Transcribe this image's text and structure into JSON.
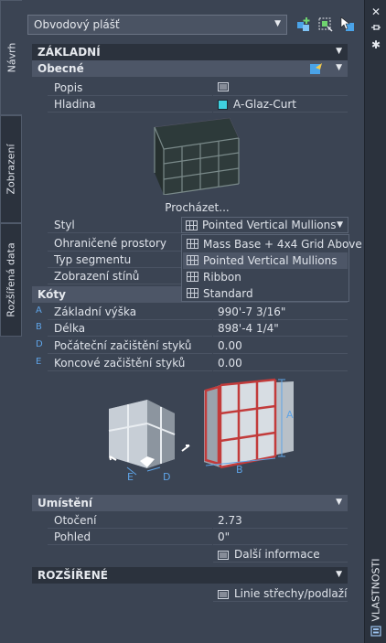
{
  "tabs": {
    "navrh": "Návrh",
    "zobrazeni": "Zobrazení",
    "rozsirena": "Rozšířená data"
  },
  "right_strip": {
    "title": "VLASTNOSTI",
    "icons": [
      "close-icon",
      "pin-icon",
      "settings-icon",
      "properties-icon"
    ]
  },
  "top": {
    "object_type": "Obvodový plášť"
  },
  "sections": {
    "zakladni": "ZÁKLADNÍ",
    "obecne": "Obecné",
    "koty": "Kóty",
    "umisteni": "Umístění",
    "rozsirene": "ROZŠÍŘENÉ"
  },
  "general": {
    "popis_label": "Popis",
    "hladina_label": "Hladina",
    "hladina_value": "A-Glaz-Curt",
    "hladina_color": "#3fd0e0",
    "browse": "Procházet...",
    "styl_label": "Styl",
    "styl_value": "Pointed Vertical Mullions",
    "ohranicene_label": "Ohraničené prostory",
    "typ_label": "Typ segmentu",
    "zobrazeni_label": "Zobrazení stínů"
  },
  "style_options": [
    "Mass Base + 4x4 Grid Above",
    "Pointed Vertical Mullions",
    "Ribbon",
    "Standard"
  ],
  "dimensions": {
    "rows": [
      {
        "letter": "A",
        "label": "Základní výška",
        "value": "990'-7 3/16\""
      },
      {
        "letter": "B",
        "label": "Délka",
        "value": "898'-4 1/4\""
      },
      {
        "letter": "D",
        "label": "Počáteční začištění styků",
        "value": "0.00"
      },
      {
        "letter": "E",
        "label": "Koncové začištění styků",
        "value": "0.00"
      }
    ],
    "diagram_labels": {
      "a": "A",
      "b": "B",
      "d": "D",
      "e": "E"
    }
  },
  "placement": {
    "otoceni_label": "Otočení",
    "otoceni_value": "2.73",
    "pohled_label": "Pohled",
    "pohled_value": "0\"",
    "more": "Další informace"
  },
  "extended": {
    "link": "Linie střechy/podlaží"
  },
  "colors": {
    "bg": "#3b4453",
    "header": "#2b323d",
    "subheader": "#4d5667",
    "accent": "#5ea3e6",
    "frame_red": "#c23b3b",
    "frame_blue": "#6f9fe0"
  }
}
